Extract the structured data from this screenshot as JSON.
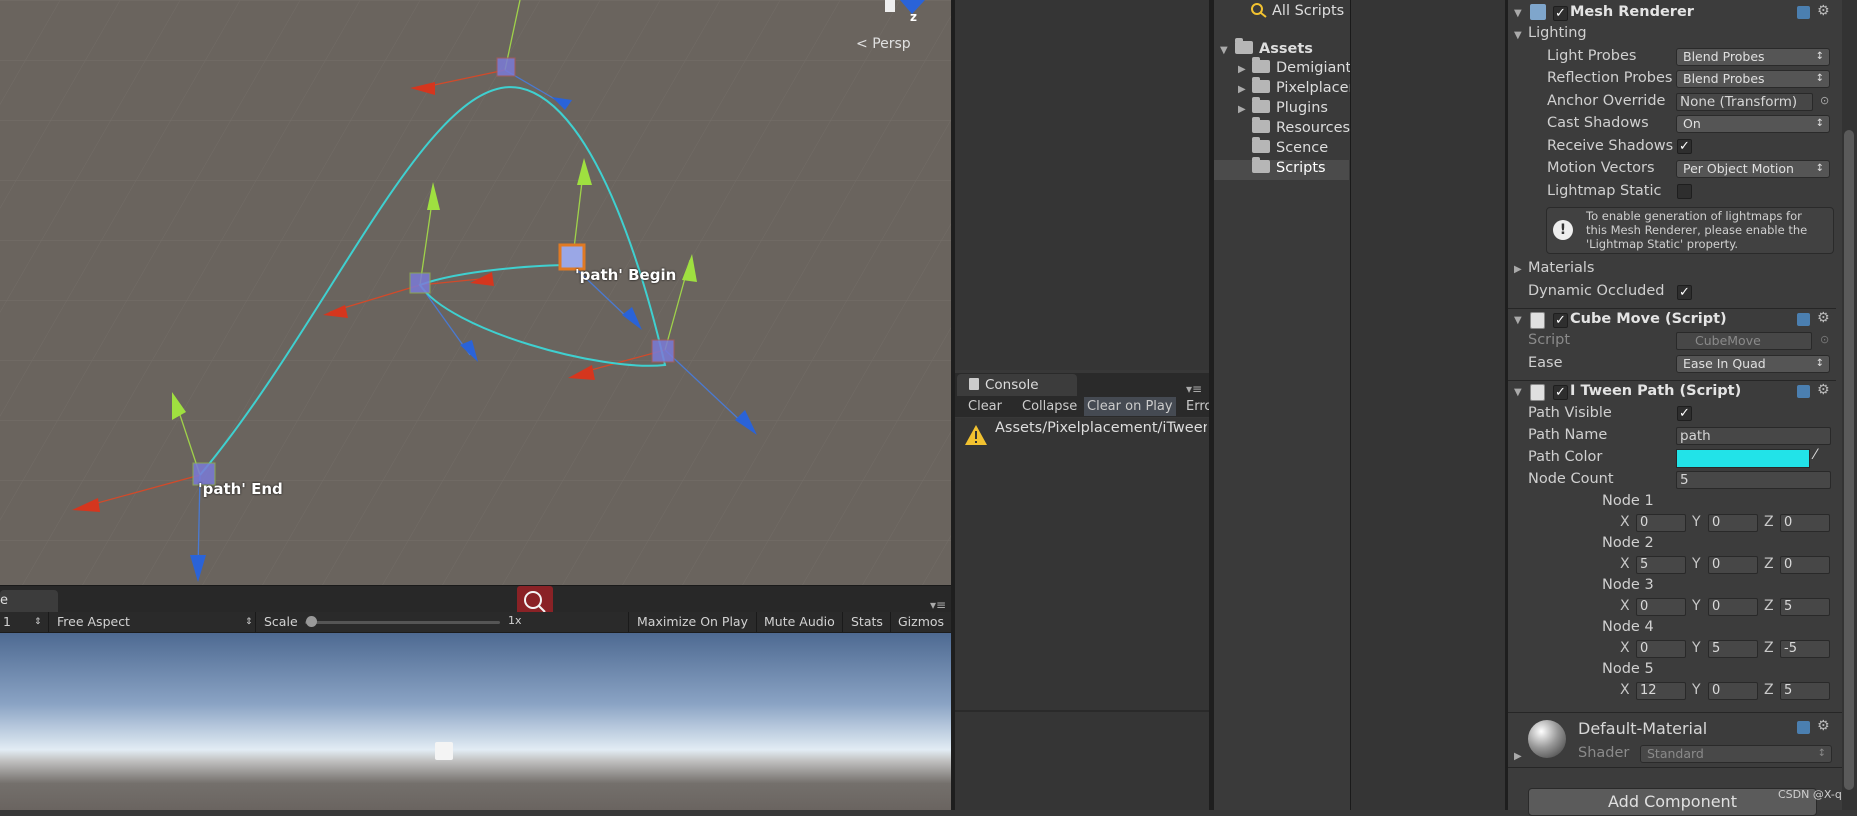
{
  "scene": {
    "persp_label": "Persp",
    "gizmo_axis": "z",
    "label_begin": "'path' Begin",
    "label_end": "'path' End",
    "path_color": "#3fd0d0"
  },
  "game": {
    "tab_label": "e",
    "display": "1",
    "aspect": "Free Aspect",
    "scale_label": "Scale",
    "scale_value": "1x",
    "maximize": "Maximize On Play",
    "mute": "Mute Audio",
    "stats": "Stats",
    "gizmos": "Gizmos"
  },
  "console": {
    "tab_label": "Console",
    "clear": "Clear",
    "collapse": "Collapse",
    "clear_on_play": "Clear on Play",
    "error_pause": "Error",
    "message": "Assets/Pixelplacement/iTween"
  },
  "project": {
    "favorite": "All Scripts",
    "root": "Assets",
    "folders": [
      "Demigiant",
      "Pixelplacer",
      "Plugins",
      "Resources",
      "Scence",
      "Scripts"
    ]
  },
  "inspector": {
    "mesh_renderer": {
      "title": "Mesh Renderer",
      "lighting": "Lighting",
      "light_probes_label": "Light Probes",
      "light_probes_value": "Blend Probes",
      "reflection_probes_label": "Reflection Probes",
      "reflection_probes_value": "Blend Probes",
      "anchor_override_label": "Anchor Override",
      "anchor_override_value": "None (Transform)",
      "cast_shadows_label": "Cast Shadows",
      "cast_shadows_value": "On",
      "receive_shadows_label": "Receive Shadows",
      "motion_vectors_label": "Motion Vectors",
      "motion_vectors_value": "Per Object Motion",
      "lightmap_static_label": "Lightmap Static",
      "info_line1": "To enable generation of lightmaps for",
      "info_line2": "this Mesh Renderer, please enable the",
      "info_line3": "'Lightmap Static' property.",
      "materials": "Materials",
      "dynamic_occluded": "Dynamic Occluded"
    },
    "cube_move": {
      "title": "Cube Move (Script)",
      "script_label": "Script",
      "script_value": "CubeMove",
      "ease_label": "Ease",
      "ease_value": "Ease In Quad"
    },
    "itween_path": {
      "title": "I Tween Path (Script)",
      "path_visible_label": "Path Visible",
      "path_name_label": "Path Name",
      "path_name_value": "path",
      "path_color_label": "Path Color",
      "path_color": "#22e3e8",
      "node_count_label": "Node Count",
      "node_count_value": "5",
      "nodes": [
        {
          "label": "Node 1",
          "x": "0",
          "y": "0",
          "z": "0"
        },
        {
          "label": "Node 2",
          "x": "5",
          "y": "0",
          "z": "0"
        },
        {
          "label": "Node 3",
          "x": "0",
          "y": "0",
          "z": "5"
        },
        {
          "label": "Node 4",
          "x": "0",
          "y": "5",
          "z": "-5"
        },
        {
          "label": "Node 5",
          "x": "12",
          "y": "0",
          "z": "5"
        }
      ]
    },
    "material": {
      "name": "Default-Material",
      "shader_label": "Shader",
      "shader_value": "Standard"
    },
    "add_component": "Add Component",
    "watermark": "CSDN @X-q-X"
  }
}
